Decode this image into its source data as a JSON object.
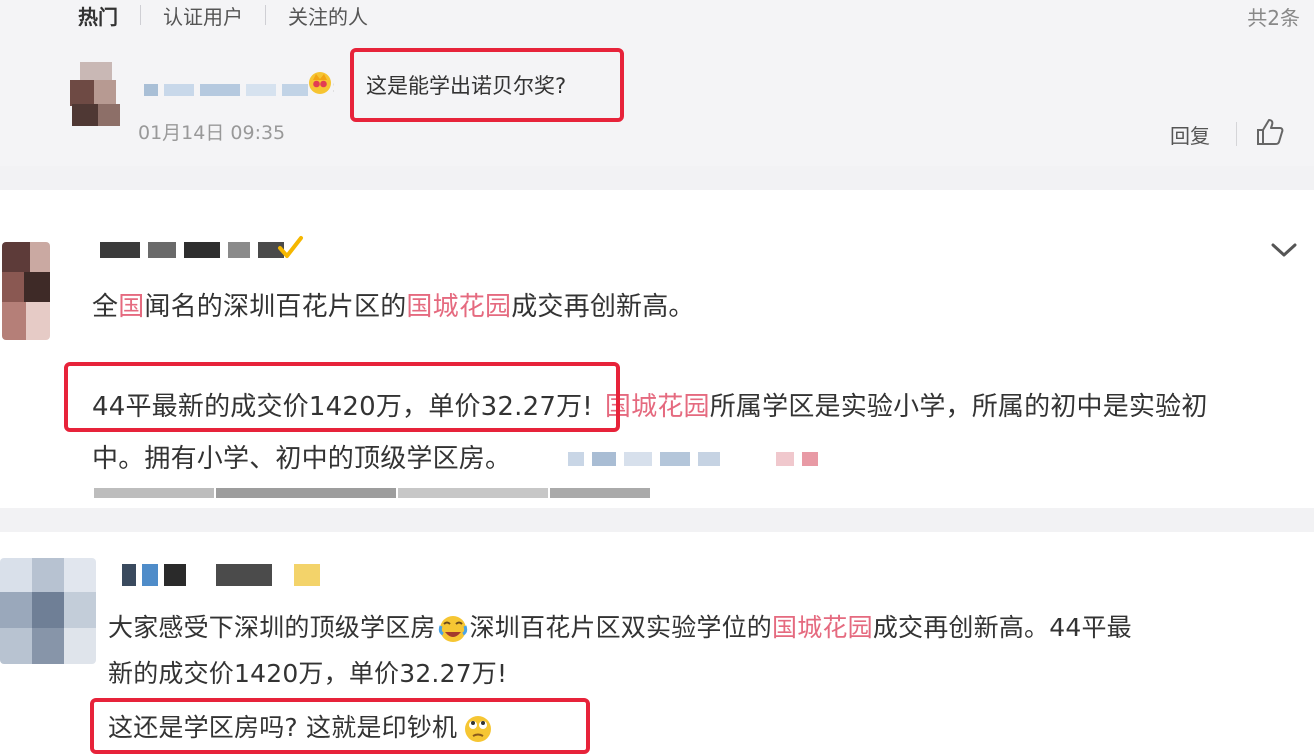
{
  "tabs": [
    {
      "label": "热门",
      "active": true
    },
    {
      "label": "认证用户",
      "active": false
    },
    {
      "label": "关注的人",
      "active": false
    }
  ],
  "total_count": "共2条",
  "reply_comment": {
    "text": "这是能学出诺贝尔奖?",
    "date": "01月14日 09:35",
    "reply_label": "回复"
  },
  "post_1": {
    "line_1": {
      "parts": [
        "全",
        "国",
        "闻名的深圳百花片区的",
        "国城花园",
        "成交再创新高。"
      ]
    },
    "line_2": {
      "boxed": "44平最新的成交价1420万，单价32.27万!",
      "hl": "国城花园",
      "rest": "所属学区是实验小学，所属的初中是实验初"
    },
    "line_3": "中。拥有小学、初中的顶级学区房。"
  },
  "post_2": {
    "line_1": {
      "a": "大家感受下深圳的顶级学区房",
      "b": "深圳百花片区双实验学位的",
      "hl": "国城花园",
      "c": "成交再创新高。44平最"
    },
    "line_2": "新的成交价1420万，单价32.27万!",
    "line_3": "这还是学区房吗? 这就是印钞机"
  },
  "colors": {
    "highlight": "#e56a7f",
    "annotation_box": "#e7233a",
    "verified": "#f5b700"
  },
  "icons": {
    "crown": "crown-badge-icon",
    "like": "thumbs-up-icon",
    "verified": "verified-check-icon",
    "chevron": "chevron-down-icon",
    "cry_laugh": "cry-laugh-emoji-icon",
    "rolling_eyes": "rolling-eyes-emoji-icon"
  }
}
